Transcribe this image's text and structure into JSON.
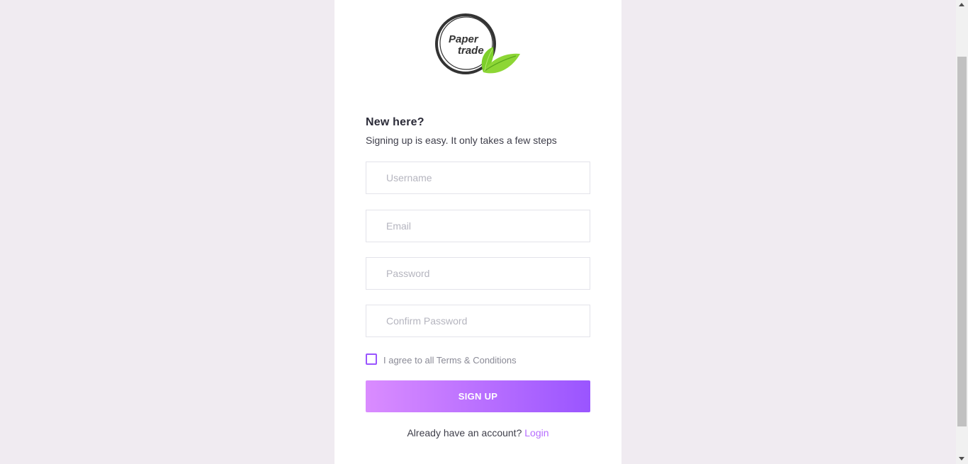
{
  "logo": {
    "line1": "Paper",
    "line2": "trade",
    "icon": "leaf-icon",
    "colors": {
      "ring": "#333333",
      "leaf": "#7ccf2a",
      "leaf_light": "#a8e05a"
    }
  },
  "form": {
    "heading": "New here?",
    "subheading": "Signing up is easy. It only takes a few steps",
    "username_placeholder": "Username",
    "email_placeholder": "Email",
    "password_placeholder": "Password",
    "confirm_password_placeholder": "Confirm Password",
    "terms_label": "I agree to all Terms & Conditions",
    "terms_checked": false,
    "submit_label": "SIGN UP",
    "login_prompt": "Already have an account?",
    "login_link": "Login"
  },
  "colors": {
    "page_background": "#f0ebf1",
    "card_background": "#ffffff",
    "accent": "#9a55ff",
    "accent_light": "#da8cff",
    "link": "#b66dff"
  }
}
